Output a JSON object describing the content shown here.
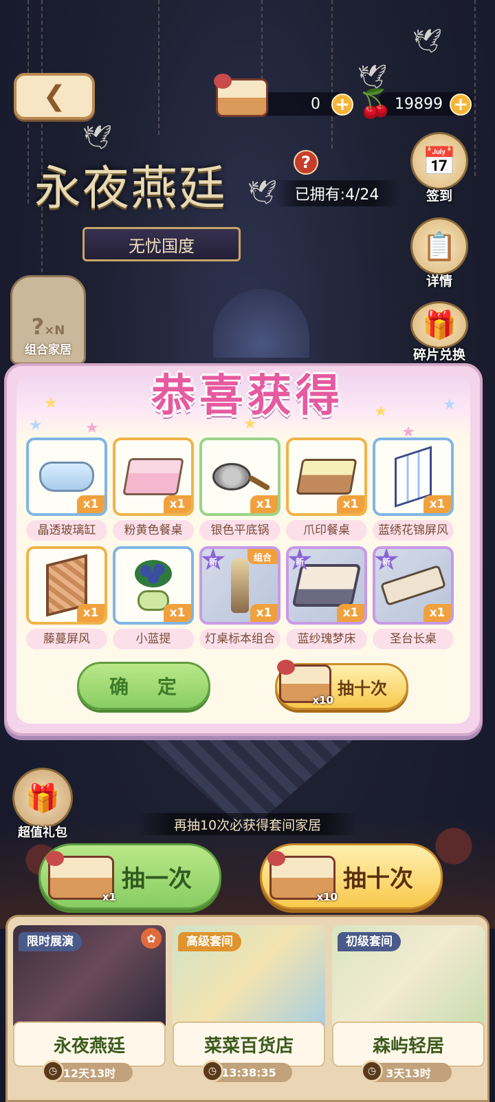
{
  "header": {
    "back_icon": "chevron-left-icon",
    "ticket_count": "0",
    "cherry_count": "19899",
    "plus": "+"
  },
  "event": {
    "title": "永夜燕廷",
    "subtitle": "无忧国度",
    "help": "?",
    "owned": "已拥有:4/24",
    "combo_label": "组合家居",
    "combo_mark": "?",
    "combo_multiplier": "×N"
  },
  "side_menu": [
    {
      "label": "签到",
      "icon": "calendar-check-icon"
    },
    {
      "label": "详情",
      "icon": "clipboard-search-icon"
    },
    {
      "label": "碎片兑换",
      "icon": "gift-box-icon"
    }
  ],
  "modal": {
    "title": "恭喜获得",
    "confirm_label": "确 定",
    "ten_label": "抽十次",
    "ten_multiplier": "x10",
    "items": [
      {
        "name": "晶透玻璃缸",
        "qty": "x1",
        "rarity": "blue",
        "new": "",
        "combo": ""
      },
      {
        "name": "粉黄色餐桌",
        "qty": "x1",
        "rarity": "orange",
        "new": "",
        "combo": ""
      },
      {
        "name": "银色平底锅",
        "qty": "x1",
        "rarity": "green",
        "new": "",
        "combo": ""
      },
      {
        "name": "爪印餐桌",
        "qty": "x1",
        "rarity": "orange",
        "new": "",
        "combo": ""
      },
      {
        "name": "蓝绣花锦屏风",
        "qty": "x1",
        "rarity": "blue",
        "new": "",
        "combo": ""
      },
      {
        "name": "藤蔓屏风",
        "qty": "x1",
        "rarity": "orange",
        "new": "",
        "combo": ""
      },
      {
        "name": "小蓝提",
        "qty": "x1",
        "rarity": "blue",
        "new": "",
        "combo": ""
      },
      {
        "name": "灯桌标本组合",
        "qty": "x1",
        "rarity": "purple",
        "new": "新",
        "combo": "组合"
      },
      {
        "name": "蓝纱瑰梦床",
        "qty": "x1",
        "rarity": "purple",
        "new": "新",
        "combo": ""
      },
      {
        "name": "圣台长桌",
        "qty": "x1",
        "rarity": "purple",
        "new": "新",
        "combo": ""
      }
    ]
  },
  "bottom": {
    "gift_label": "超值礼包",
    "hint": "再抽10次必获得套间家居",
    "draw_one_label": "抽一次",
    "draw_one_multiplier": "x1",
    "draw_ten_label": "抽十次",
    "draw_ten_multiplier": "x10"
  },
  "suites": [
    {
      "tag": "限时展演",
      "name": "永夜燕廷",
      "timer": "12天13时",
      "tag_color": "#5a6fb0"
    },
    {
      "tag": "高级套间",
      "name": "菜菜百货店",
      "timer": "13:38:35",
      "tag_color": "#e0932e"
    },
    {
      "tag": "初级套间",
      "name": "森屿轻居",
      "timer": "3天13时",
      "tag_color": "#5a6fb0"
    }
  ]
}
